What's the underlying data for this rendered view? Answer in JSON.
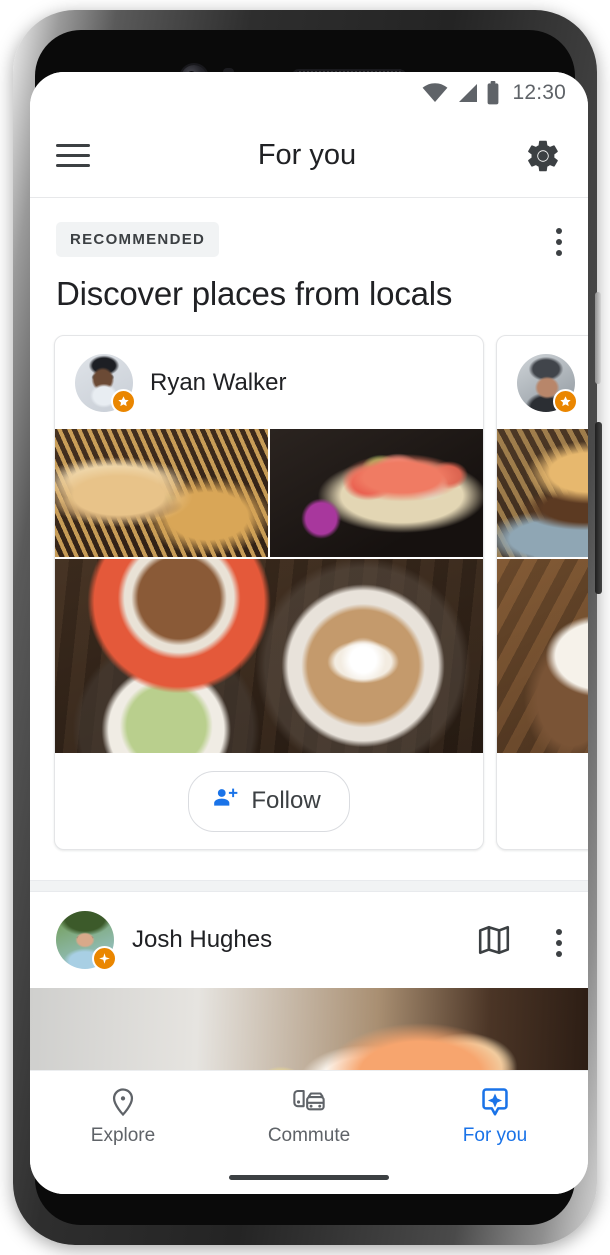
{
  "status_bar": {
    "time": "12:30",
    "wifi_icon": "wifi-icon",
    "signal_icon": "cellular-signal-icon",
    "battery_icon": "battery-icon"
  },
  "app_bar": {
    "menu_icon": "hamburger-menu-icon",
    "title": "For you",
    "settings_icon": "gear-icon"
  },
  "section": {
    "chip_label": "RECOMMENDED",
    "overflow_icon": "more-vert-icon",
    "title": "Discover places from locals"
  },
  "cards": [
    {
      "author": "Ryan Walker",
      "avatar_name": "avatar-ryan-walker",
      "badge_icon": "local-guide-star-badge",
      "photos": [
        {
          "name": "photo-burger-and-fries"
        },
        {
          "name": "photo-sushi-boat"
        },
        {
          "name": "photo-coffee-latte-matcha"
        }
      ],
      "follow": {
        "label": "Follow",
        "icon": "person-add-icon"
      }
    },
    {
      "author": "",
      "avatar_name": "avatar-second-local-guide",
      "badge_icon": "local-guide-star-badge",
      "photos": [
        {
          "name": "photo-fried-chicken-burger"
        },
        {
          "name": "photo-drink-closeup"
        }
      ]
    }
  ],
  "feed_item": {
    "author": "Josh Hughes",
    "avatar_name": "avatar-josh-hughes",
    "badge_icon": "local-guide-sparkle-badge",
    "map_icon": "map-icon",
    "overflow_icon": "more-vert-icon",
    "photo_name": "photo-salmon-sashimi"
  },
  "bottom_nav": {
    "items": [
      {
        "label": "Explore",
        "icon": "place-pin-icon",
        "active": false
      },
      {
        "label": "Commute",
        "icon": "commute-bus-car-icon",
        "active": false
      },
      {
        "label": "For you",
        "icon": "for-you-sparkle-icon",
        "active": true
      }
    ],
    "active_color": "#1a73e8",
    "inactive_color": "#5f6368"
  },
  "colors": {
    "accent_blue": "#1a73e8",
    "badge_orange": "#ea8600",
    "chip_bg": "#f1f3f4",
    "text_primary": "#202124",
    "text_secondary": "#5f6368"
  }
}
